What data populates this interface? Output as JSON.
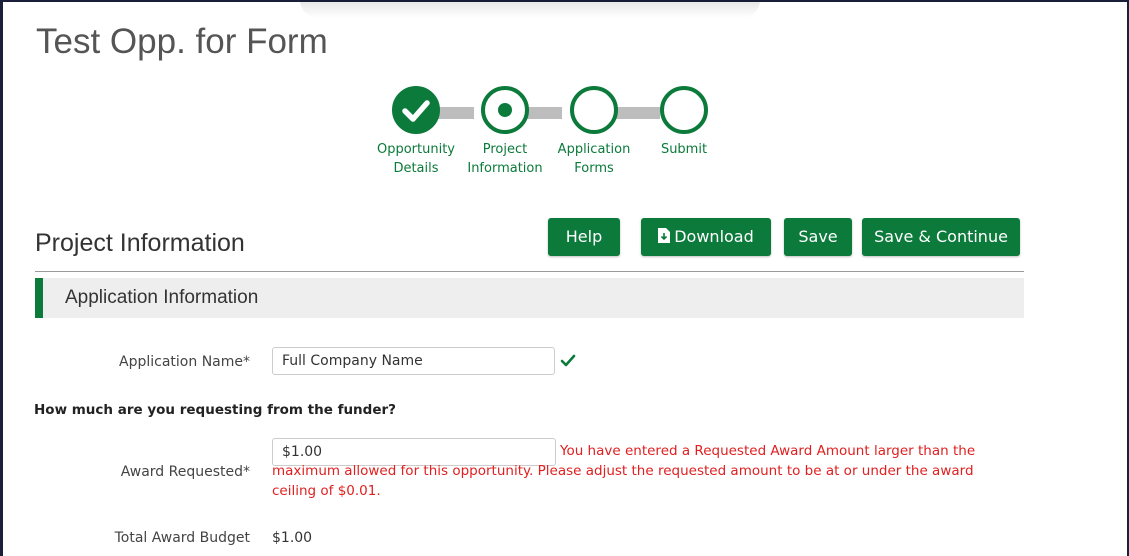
{
  "opportunity_title": "Test Opp. for Form",
  "stepper": {
    "steps": [
      {
        "line1": "Opportunity",
        "line2": "Details",
        "state": "complete"
      },
      {
        "line1": "Project",
        "line2": "Information",
        "state": "current"
      },
      {
        "line1": "Application",
        "line2": "Forms",
        "state": "pending"
      },
      {
        "line1": "Submit",
        "line2": "",
        "state": "pending"
      }
    ]
  },
  "header": {
    "title": "Project Information",
    "buttons": {
      "help": "Help",
      "download": "Download",
      "save": "Save",
      "save_continue": "Save & Continue"
    }
  },
  "panel": {
    "title": "Application Information"
  },
  "form": {
    "application_name": {
      "label": "Application Name*",
      "value": "Full Company Name",
      "valid": true
    },
    "question": "How much are you requesting from the funder?",
    "award_requested": {
      "label": "Award Requested*",
      "value": "$1.00",
      "error": "You have entered a Requested Award Amount larger than the maximum allowed for this opportunity. Please adjust the requested amount to be at or under the award ceiling of $0.01."
    },
    "total_award_budget": {
      "label": "Total Award Budget",
      "value": "$1.00"
    }
  },
  "colors": {
    "accent": "#0b7a3b",
    "error": "#e02020",
    "panel_bg": "#eeeeee"
  },
  "icons": {
    "step_complete": "check-icon",
    "download": "download-file-icon",
    "valid": "check-icon"
  }
}
